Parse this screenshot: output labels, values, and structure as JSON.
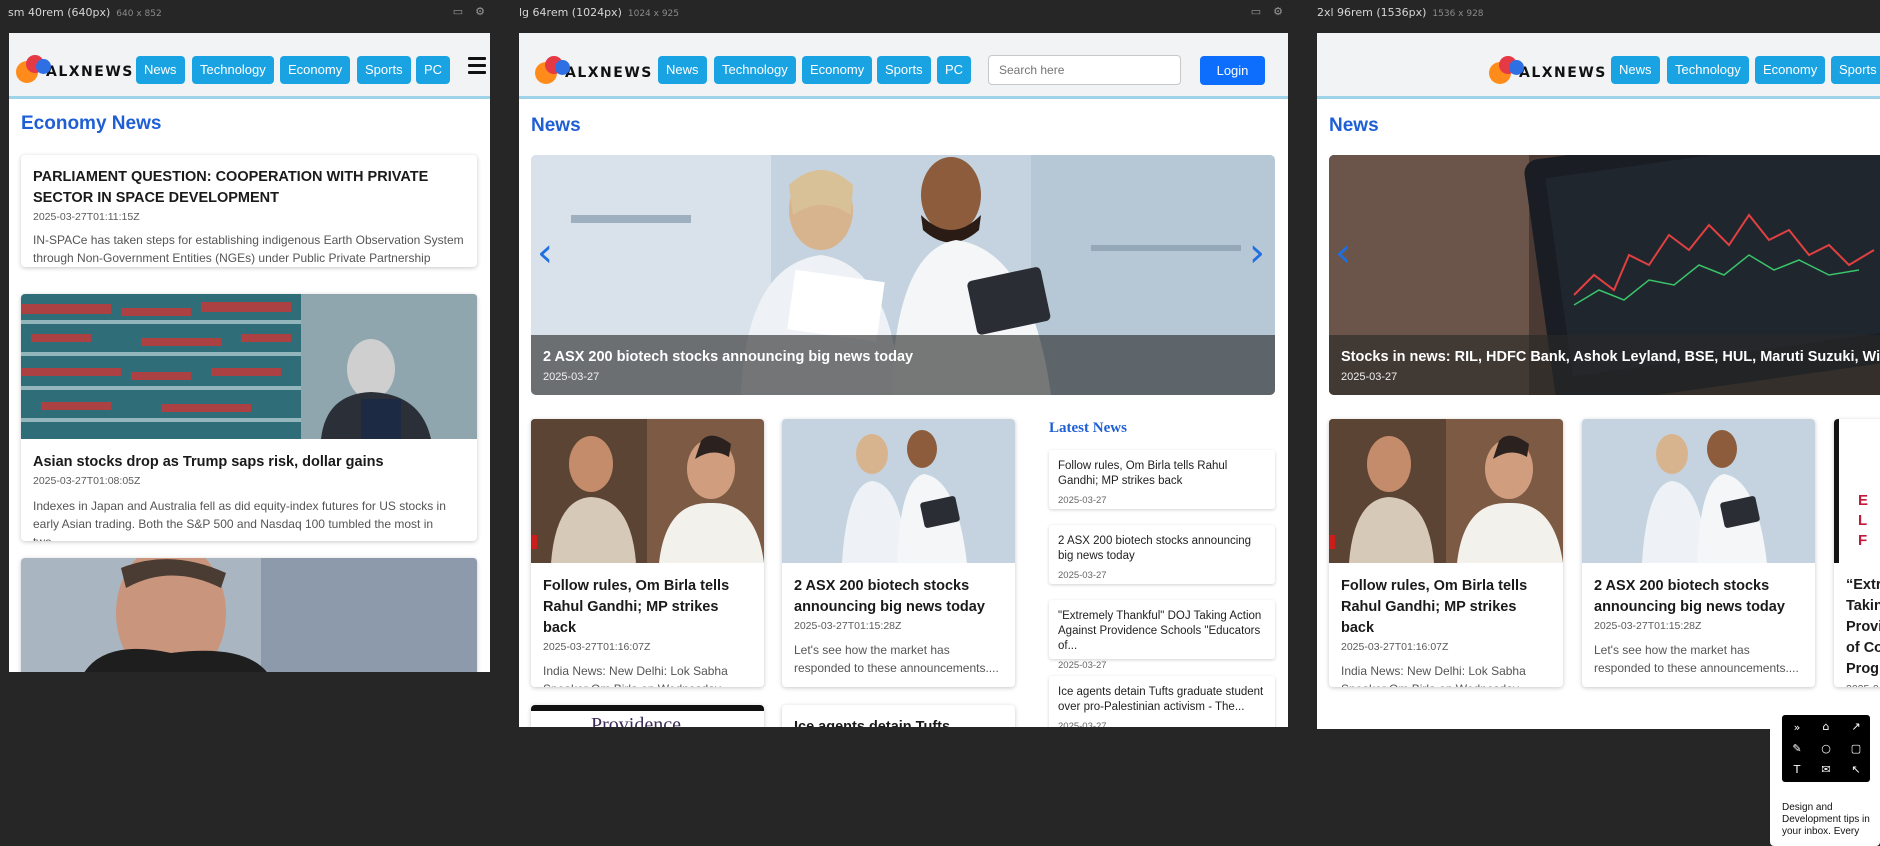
{
  "brand": "ALXNEWS",
  "frames": [
    {
      "label": "sm 40rem (640px)",
      "size": "640 x 852"
    },
    {
      "label": "lg 64rem (1024px)",
      "size": "1024 x 925"
    },
    {
      "label": "2xl 96rem (1536px)",
      "size": "1536 x 928"
    }
  ],
  "nav": [
    "News",
    "Technology",
    "Economy",
    "Sports",
    "PC"
  ],
  "search_placeholder": "Search here",
  "login_label": "Login",
  "sm": {
    "section_title": "Economy News",
    "cards": [
      {
        "title": "PARLIAMENT QUESTION: COOPERATION WITH PRIVATE SECTOR IN SPACE DEVELOPMENT",
        "date": "2025-03-27T01:11:15Z",
        "desc": "IN-SPACe has taken steps for establishing indigenous Earth Observation System through Non-Government Entities (NGEs) under Public Private Partnership (PPP)"
      },
      {
        "title": "Asian stocks drop as Trump saps risk, dollar gains",
        "date": "2025-03-27T01:08:05Z",
        "desc": "Indexes in Japan and Australia fell as did equity-index futures for US stocks in early Asian trading. Both the S&P 500 and Nasdaq 100 tumbled the most in two..."
      }
    ]
  },
  "lg": {
    "section_title": "News",
    "hero": {
      "title": "2 ASX 200 biotech stocks announcing big news today",
      "date": "2025-03-27"
    },
    "cards": [
      {
        "title": "Follow rules, Om Birla tells Rahul Gandhi; MP strikes back",
        "date": "2025-03-27T01:16:07Z",
        "desc": "India News: New Delhi: Lok Sabha Speaker Om Birla on Wednesday..."
      },
      {
        "title": "2 ASX 200 biotech stocks announcing big news today",
        "date": "2025-03-27T01:15:28Z",
        "desc": "Let's see how the market has responded to these announcements...."
      }
    ],
    "bottom_card_title": "Ice agents detain Tufts graduate",
    "providence_text": "Providence",
    "latest_title": "Latest News",
    "latest": [
      {
        "title": "Follow rules, Om Birla tells Rahul Gandhi; MP strikes back",
        "date": "2025-03-27"
      },
      {
        "title": "2 ASX 200 biotech stocks announcing big news today",
        "date": "2025-03-27"
      },
      {
        "title": "\"Extremely Thankful\" DOJ Taking Action Against Providence Schools \"Educators of...",
        "date": "2025-03-27"
      },
      {
        "title": "Ice agents detain Tufts graduate student over pro-Palestinian activism - The...",
        "date": "2025-03-27"
      }
    ]
  },
  "xl": {
    "section_title": "News",
    "hero": {
      "title": "Stocks in news: RIL, HDFC Bank, Ashok Leyland, BSE, HUL, Maruti Suzuki, Wipro",
      "date": "2025-03-27"
    },
    "cards": [
      {
        "title": "Follow rules, Om Birla tells Rahul Gandhi; MP strikes back",
        "date": "2025-03-27T01:16:07Z",
        "desc": "India News: New Delhi: Lok Sabha Speaker Om Birla on Wednesday..."
      },
      {
        "title": "2 ASX 200 biotech stocks announcing big news today",
        "date": "2025-03-27T01:15:28Z",
        "desc": "Let's see how the market has responded to these announcements...."
      }
    ],
    "partial_lines": [
      "“Extr",
      "Takin",
      "Provi",
      "of Co",
      "Progr"
    ],
    "partial_date": "2025-0",
    "partial_red": [
      "E",
      "L",
      "F"
    ]
  },
  "overlay_text": "Design and Development tips in your inbox. Every",
  "colors": {
    "accent": "#1aa3e2",
    "login": "#0d6efd",
    "title_blue": "#1f5fd6"
  }
}
